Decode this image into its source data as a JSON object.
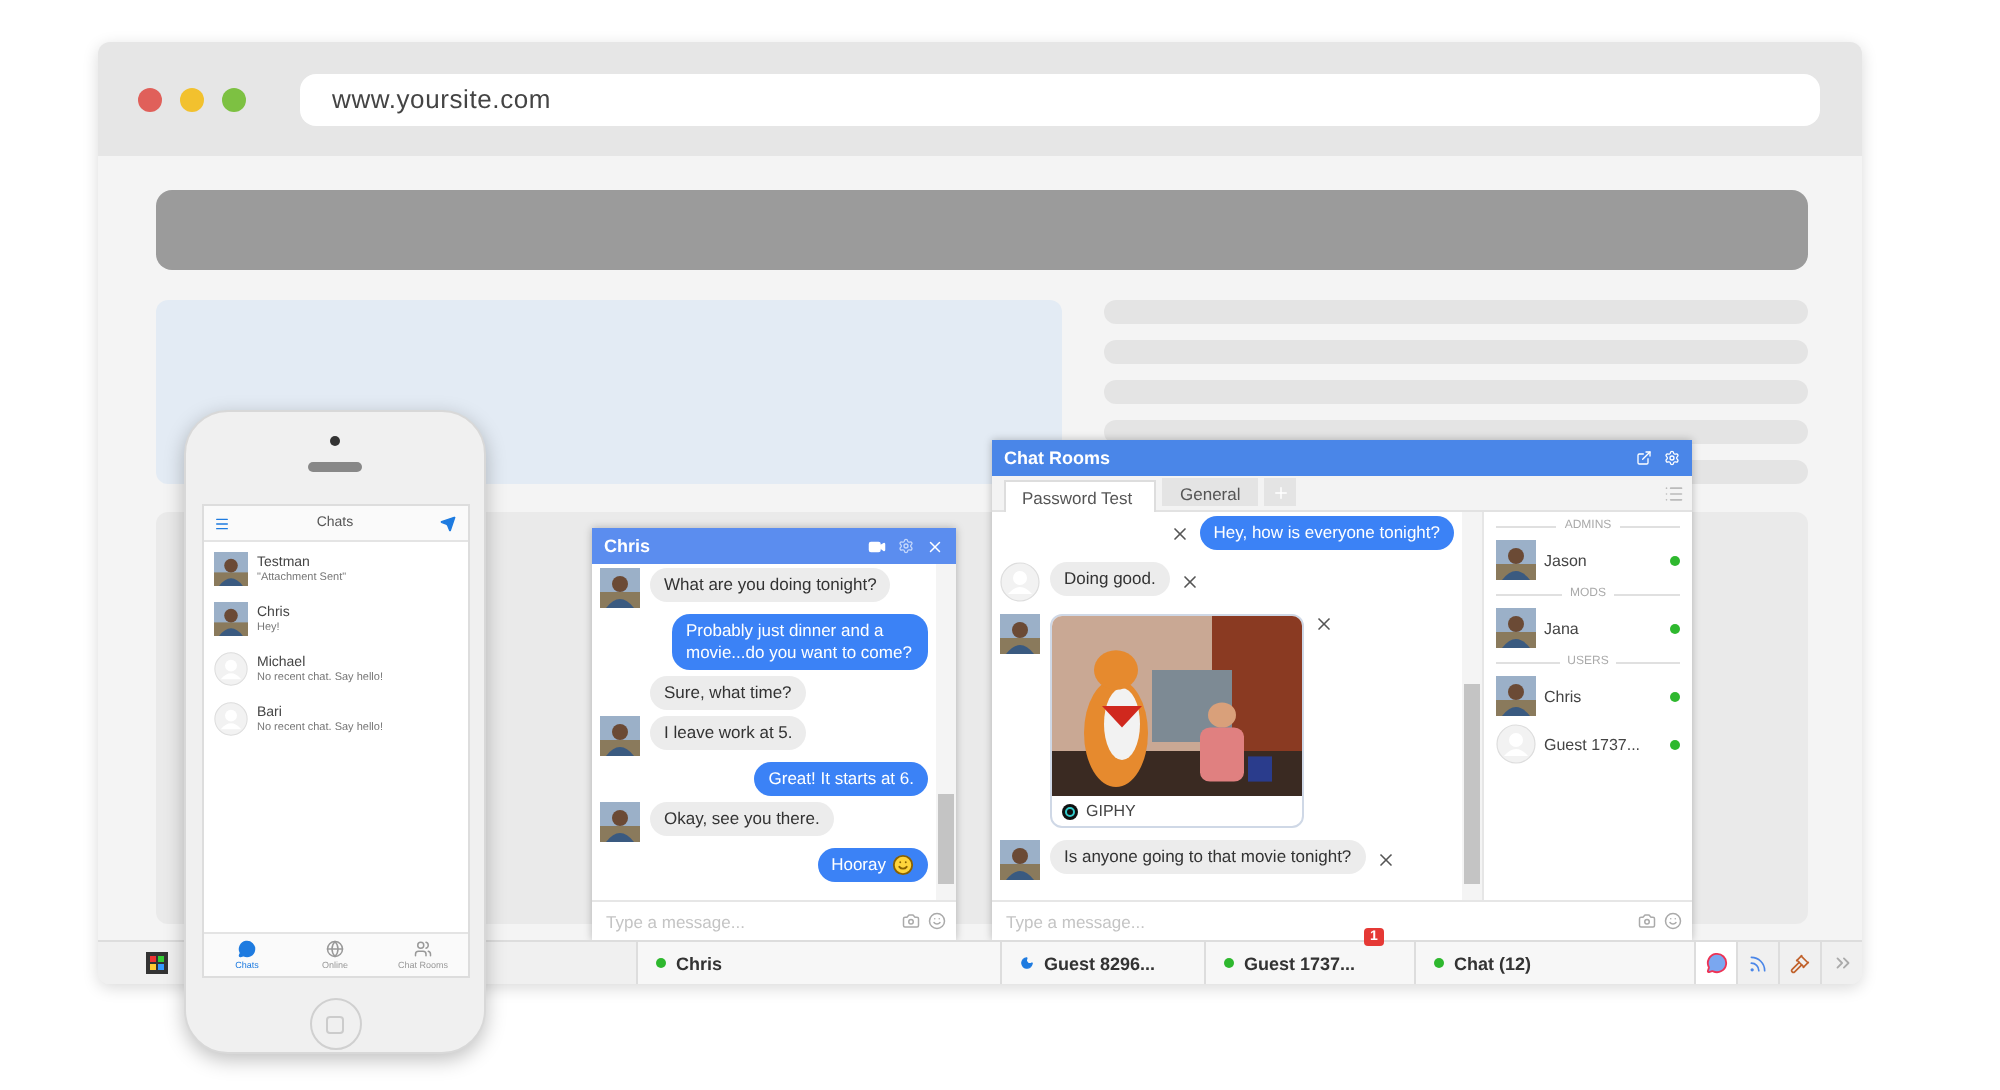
{
  "browser": {
    "address": "www.yoursite.com"
  },
  "phone": {
    "title": "Chats",
    "conversations": [
      {
        "name": "Testman",
        "preview": "\"Attachment Sent\"",
        "has_photo": true
      },
      {
        "name": "Chris",
        "preview": "Hey!",
        "has_photo": true
      },
      {
        "name": "Michael",
        "preview": "No recent chat. Say hello!",
        "has_photo": false
      },
      {
        "name": "Bari",
        "preview": "No recent chat. Say hello!",
        "has_photo": false
      }
    ],
    "tabs": [
      {
        "label": "Chats",
        "kind": "chats",
        "selected": true
      },
      {
        "label": "Online",
        "kind": "online",
        "selected": false
      },
      {
        "label": "Chat Rooms",
        "kind": "rooms",
        "selected": false
      }
    ]
  },
  "chat_window": {
    "title": "Chris",
    "messages": [
      {
        "text": "What are you doing tonight?",
        "outgoing": false,
        "avatar": true
      },
      {
        "text": "Probably just dinner and a movie...do you want to come?",
        "outgoing": true
      },
      {
        "text": "Sure, what time?",
        "outgoing": false,
        "avatar": false
      },
      {
        "text": "I leave work at 5.",
        "outgoing": false,
        "avatar": true
      },
      {
        "text": "Great! It starts at 6.",
        "outgoing": true
      },
      {
        "text": "Okay, see you there.",
        "outgoing": false,
        "avatar": true
      },
      {
        "text": "Hooray",
        "outgoing": true,
        "smiley": true
      }
    ],
    "placeholder": "Type a message...",
    "footer": {
      "name": "Chris",
      "online": true
    }
  },
  "chat_rooms": {
    "title": "Chat Rooms",
    "tabs": [
      {
        "label": "Password Test",
        "selected": true
      },
      {
        "label": "General",
        "selected": false
      }
    ],
    "messages": [
      {
        "kind": "text",
        "text": "Hey, how is everyone tonight?",
        "outgoing": true
      },
      {
        "kind": "text",
        "text": "Doing good.",
        "outgoing": false,
        "has_photo": false
      },
      {
        "kind": "gif",
        "caption": "GIPHY",
        "outgoing": false,
        "has_photo": true
      },
      {
        "kind": "text",
        "text": "Is anyone going to that movie tonight?",
        "outgoing": false,
        "has_photo": true
      }
    ],
    "groups": [
      {
        "heading": "ADMINS",
        "users": [
          {
            "name": "Jason",
            "has_photo": true,
            "online": true
          }
        ]
      },
      {
        "heading": "MODS",
        "users": [
          {
            "name": "Jana",
            "has_photo": true,
            "online": true
          }
        ]
      },
      {
        "heading": "USERS",
        "users": [
          {
            "name": "Chris",
            "has_photo": true,
            "online": true
          },
          {
            "name": "Guest 1737...",
            "has_photo": false,
            "online": true
          }
        ]
      }
    ],
    "placeholder": "Type a message..."
  },
  "taskbar": {
    "tabs": [
      {
        "label": "Guest 8296...",
        "away": true
      },
      {
        "label": "Guest 1737...",
        "away": false,
        "badge": "1"
      },
      {
        "label": "Chat (**12**)",
        "away": false
      }
    ]
  }
}
